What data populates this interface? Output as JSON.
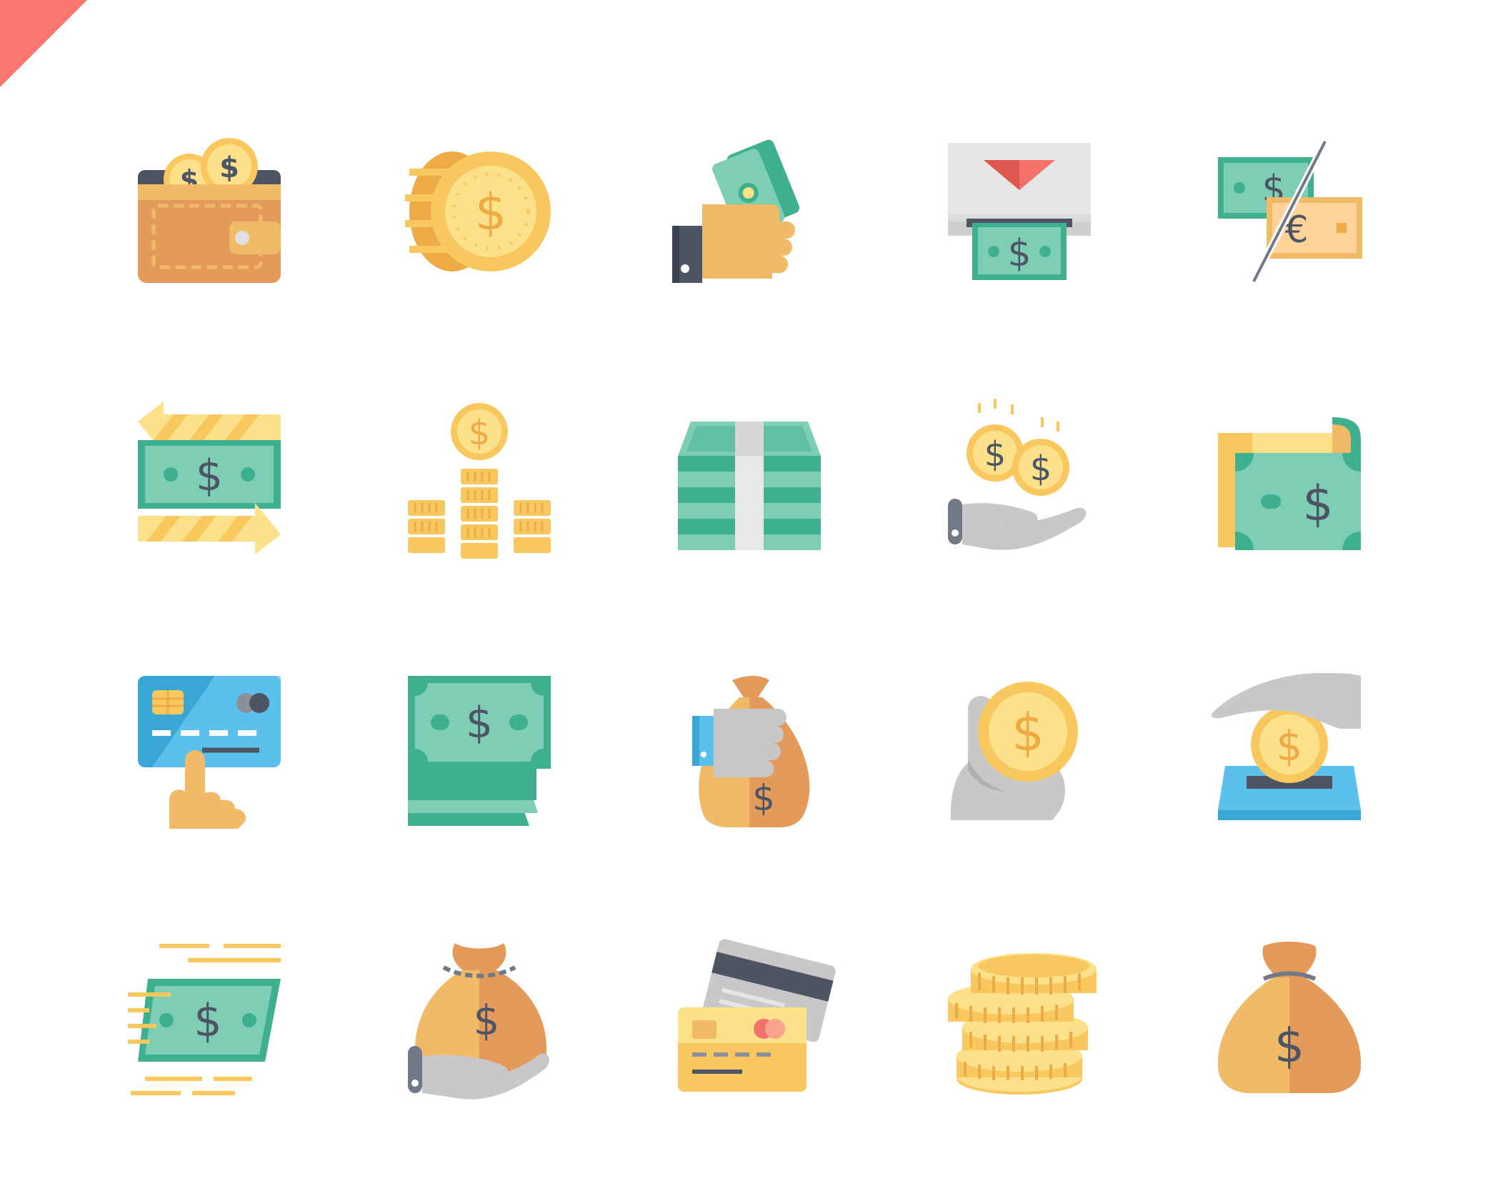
{
  "colors": {
    "corner": "#f87570",
    "gold": "#f8c85f",
    "gold_light": "#fde08a",
    "gold_dark": "#eeab45",
    "green": "#7ecdb5",
    "green_dark": "#3fb08f",
    "skin": "#f1ba67",
    "gray": "#c8c8c8",
    "dark": "#4d5564",
    "brown": "#e39a5a",
    "blue": "#5bc0ec",
    "blue_dark": "#3aa6d6",
    "red": "#f27168"
  },
  "icons": [
    {
      "name": "wallet-coins-icon",
      "symbol": "$"
    },
    {
      "name": "gold-coin-icon",
      "symbol": "$"
    },
    {
      "name": "hand-holding-cash-icon",
      "symbol": "$"
    },
    {
      "name": "atm-cash-withdrawal-icon",
      "symbol": "$"
    },
    {
      "name": "currency-exchange-icon",
      "symbol": "$",
      "symbol2": "€"
    },
    {
      "name": "money-transfer-icon",
      "symbol": "$"
    },
    {
      "name": "coin-stacks-growth-icon",
      "symbol": "$"
    },
    {
      "name": "banknote-bundle-icon",
      "symbol": "$"
    },
    {
      "name": "hand-receiving-coins-icon",
      "symbol": "$"
    },
    {
      "name": "rolled-banknote-icon",
      "symbol": "$"
    },
    {
      "name": "credit-card-payment-icon",
      "symbol": ""
    },
    {
      "name": "banknote-stack-icon",
      "symbol": "$"
    },
    {
      "name": "hand-holding-money-bag-icon",
      "symbol": "$"
    },
    {
      "name": "hand-holding-coin-icon",
      "symbol": "$"
    },
    {
      "name": "coin-deposit-icon",
      "symbol": "$"
    },
    {
      "name": "fast-payment-icon",
      "symbol": "$"
    },
    {
      "name": "hand-with-money-bag-icon",
      "symbol": "$"
    },
    {
      "name": "credit-cards-icon",
      "symbol": ""
    },
    {
      "name": "coin-stack-icon",
      "symbol": ""
    },
    {
      "name": "money-bag-icon",
      "symbol": "$"
    }
  ]
}
